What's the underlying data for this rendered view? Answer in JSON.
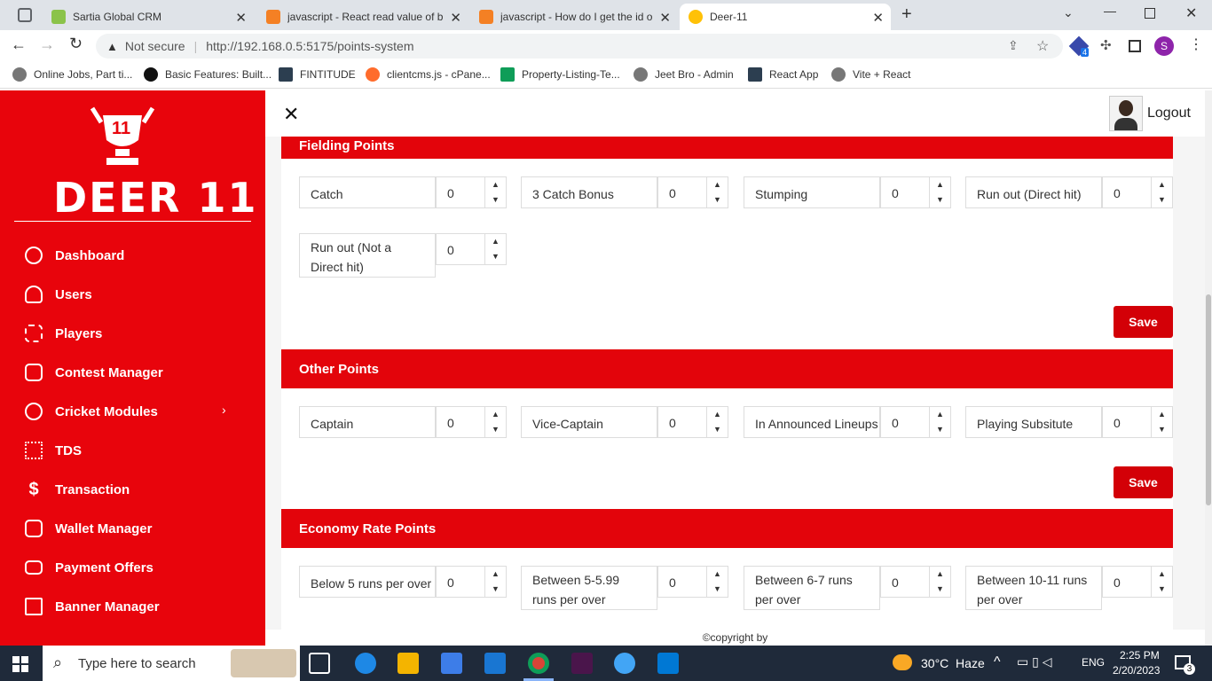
{
  "browser": {
    "tabs": [
      {
        "title": "Sartia Global CRM",
        "active": false
      },
      {
        "title": "javascript - React read value of bu",
        "active": false
      },
      {
        "title": "javascript - How do I get the id o",
        "active": false
      },
      {
        "title": "Deer-11",
        "active": true
      }
    ],
    "security": "Not secure",
    "url": "http://192.168.0.5:5175/points-system",
    "bookmarks": [
      "Online Jobs, Part ti...",
      "Basic Features: Built...",
      "FINTITUDE",
      "clientcms.js - cPane...",
      "Property-Listing-Te...",
      "Jeet Bro - Admin",
      "React App",
      "Vite + React"
    ],
    "profile_initial": "S",
    "extension_badge": "4"
  },
  "sidebar": {
    "logo_badge": "11",
    "logo_text": "DEER 11",
    "items": [
      {
        "label": "Dashboard",
        "icon": "dashboard-icon"
      },
      {
        "label": "Users",
        "icon": "users-icon"
      },
      {
        "label": "Players",
        "icon": "grid-icon"
      },
      {
        "label": "Contest Manager",
        "icon": "contest-icon"
      },
      {
        "label": "Cricket Modules",
        "icon": "cricket-ball-icon",
        "chevron": "›"
      },
      {
        "label": "TDS",
        "icon": "flow-icon"
      },
      {
        "label": "Transaction",
        "icon": "dollar-icon"
      },
      {
        "label": "Wallet Manager",
        "icon": "wallet-icon"
      },
      {
        "label": "Payment Offers",
        "icon": "card-icon"
      },
      {
        "label": "Banner Manager",
        "icon": "banner-icon"
      }
    ]
  },
  "header": {
    "close_glyph": "✕",
    "logout_label": "Logout"
  },
  "sections": [
    {
      "title": "Fielding Points",
      "fields": [
        {
          "label": "Catch",
          "value": "0"
        },
        {
          "label": "3 Catch Bonus",
          "value": "0"
        },
        {
          "label": "Stumping",
          "value": "0"
        },
        {
          "label": "Run out (Direct hit)",
          "value": "0"
        },
        {
          "label": "Run out (Not a Direct hit)",
          "value": "0"
        }
      ],
      "save_label": "Save"
    },
    {
      "title": "Other Points",
      "fields": [
        {
          "label": "Captain",
          "value": "0"
        },
        {
          "label": "Vice-Captain",
          "value": "0"
        },
        {
          "label": "In Announced Lineups",
          "value": "0"
        },
        {
          "label": "Playing Subsitute",
          "value": "0"
        }
      ],
      "save_label": "Save"
    },
    {
      "title": "Economy Rate Points",
      "fields": [
        {
          "label": "Below 5 runs per over",
          "value": "0"
        },
        {
          "label": "Between 5-5.99 runs per over",
          "value": "0"
        },
        {
          "label": "Between 6-7 runs per over",
          "value": "0"
        },
        {
          "label": "Between 10-11 runs per over",
          "value": "0"
        }
      ]
    }
  ],
  "footer": {
    "text": "©copyright by"
  },
  "taskbar": {
    "search_placeholder": "Type here to search",
    "weather": "30°C  Haze",
    "language": "ENG",
    "time": "2:25 PM",
    "date": "2/20/2023",
    "notifications": "3"
  },
  "colors": {
    "brand_red": "#e8040c",
    "save_red": "#d30007"
  }
}
